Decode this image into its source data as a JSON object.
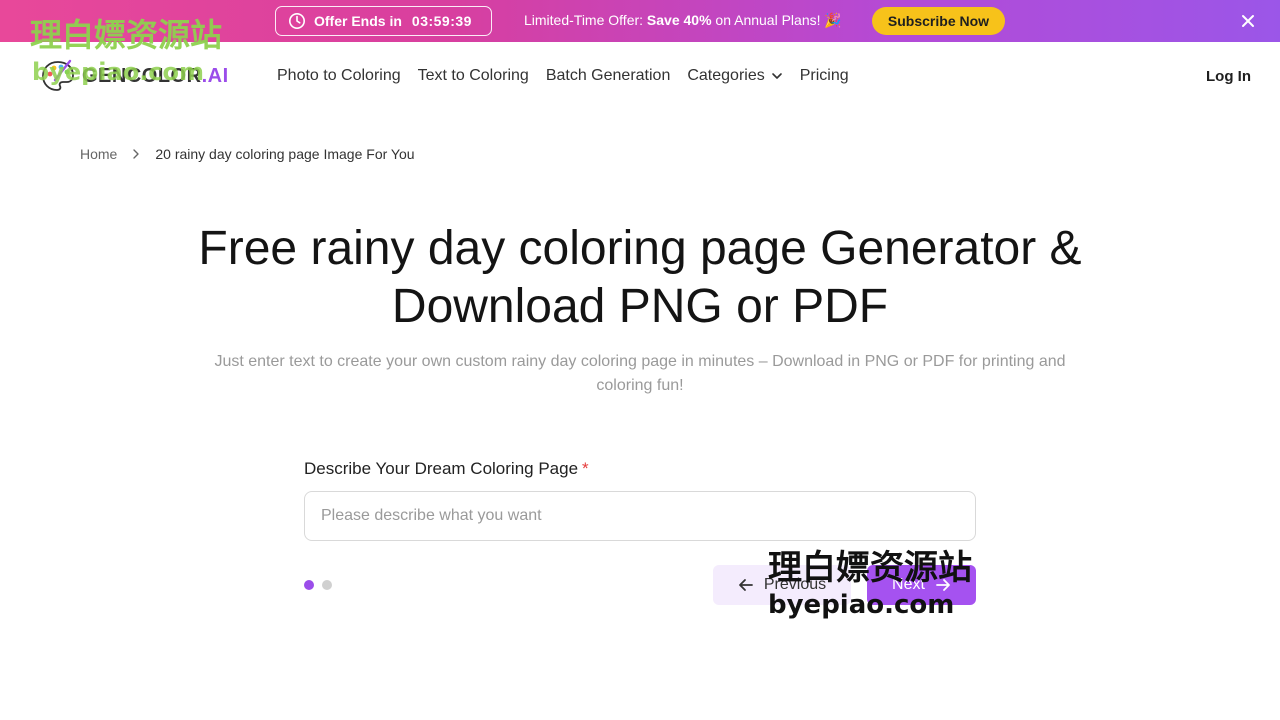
{
  "promo": {
    "timer_label": "Offer Ends in",
    "timer_value": "03:59:39",
    "text_prefix": "Limited-Time Offer: ",
    "text_bold": "Save 40%",
    "text_suffix": " on Annual Plans! 🎉",
    "subscribe_label": "Subscribe Now",
    "close_icon": "close-icon"
  },
  "nav": {
    "brand": "GENCOLOR",
    "brand_suffix": ".AI",
    "links": [
      "Photo to Coloring",
      "Text to Coloring",
      "Batch Generation",
      "Categories",
      "Pricing"
    ],
    "login_label": "Log In"
  },
  "breadcrumb": {
    "home": "Home",
    "current": "20 rainy day coloring page Image For You"
  },
  "hero": {
    "title": "Free rainy day coloring page Generator & Download PNG or PDF",
    "subtitle": "Just enter text to create your own custom rainy day coloring page in minutes – Download in PNG or PDF for printing and coloring fun!"
  },
  "form": {
    "label": "Describe Your Dream Coloring Page",
    "required_mark": "*",
    "input_value": "",
    "placeholder": "Please describe what you want",
    "step_current": 1,
    "step_total": 2,
    "previous_label": "Previous",
    "next_label": "Next"
  },
  "watermark": {
    "text": "理白嫖资源站",
    "url": "byepiao.com"
  },
  "colors": {
    "accent": "#a552f0",
    "subscribe": "#f7c21a",
    "required": "#e53b3b"
  }
}
